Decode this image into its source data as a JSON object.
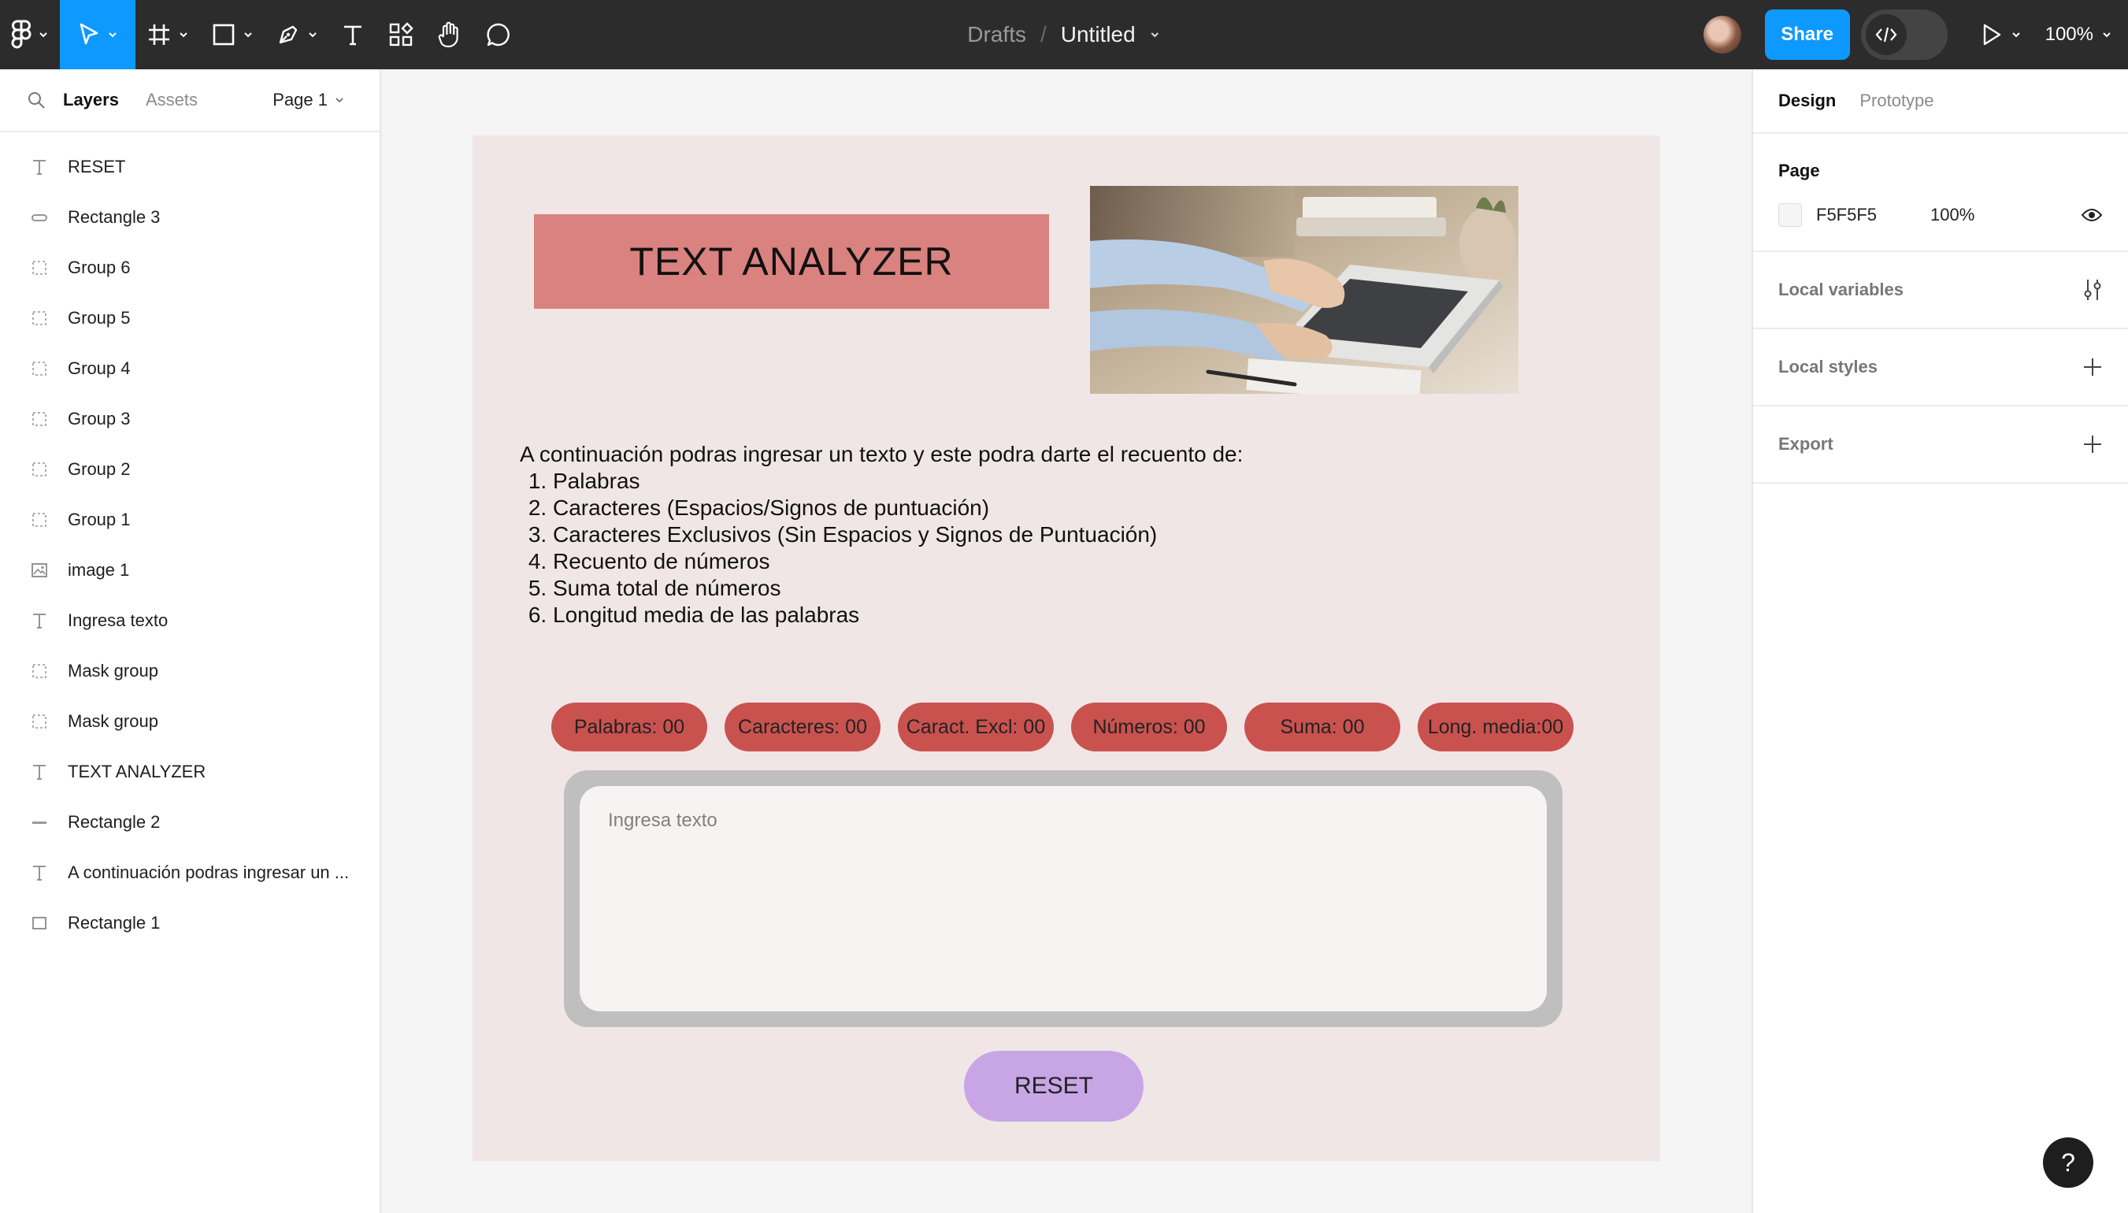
{
  "toolbar": {
    "file": {
      "drafts": "Drafts",
      "separator": "/",
      "name": "Untitled"
    },
    "share_label": "Share",
    "zoom": "100%"
  },
  "left_panel": {
    "tabs": {
      "layers": "Layers",
      "assets": "Assets"
    },
    "page_selector": "Page 1",
    "layers": [
      {
        "label": "RESET",
        "icon": "text-icon"
      },
      {
        "label": "Rectangle 3",
        "icon": "rounded-rect-icon"
      },
      {
        "label": "Group 6",
        "icon": "group-icon"
      },
      {
        "label": "Group 5",
        "icon": "group-icon"
      },
      {
        "label": "Group 4",
        "icon": "group-icon"
      },
      {
        "label": "Group 3",
        "icon": "group-icon"
      },
      {
        "label": "Group 2",
        "icon": "group-icon"
      },
      {
        "label": "Group 1",
        "icon": "group-icon"
      },
      {
        "label": "image 1",
        "icon": "image-icon"
      },
      {
        "label": "Ingresa texto",
        "icon": "text-icon"
      },
      {
        "label": "Mask group",
        "icon": "group-icon"
      },
      {
        "label": "Mask group",
        "icon": "group-icon"
      },
      {
        "label": "TEXT ANALYZER",
        "icon": "text-icon"
      },
      {
        "label": "Rectangle 2",
        "icon": "line-rect-icon"
      },
      {
        "label": "A continuación podras ingresar un ...",
        "icon": "text-icon"
      },
      {
        "label": "Rectangle 1",
        "icon": "rect-icon"
      }
    ]
  },
  "right_panel": {
    "tabs": {
      "design": "Design",
      "prototype": "Prototype"
    },
    "page": {
      "title": "Page",
      "color_hex": "F5F5F5",
      "opacity": "100%"
    },
    "local_variables": "Local variables",
    "local_styles": "Local styles",
    "export": "Export"
  },
  "help": "?",
  "design": {
    "title": "TEXT ANALYZER",
    "intro": "A continuación podras ingresar un texto y este podra darte el recuento de:",
    "list": [
      "Palabras",
      "Caracteres (Espacios/Signos de puntuación)",
      "Caracteres Exclusivos (Sin Espacios y Signos de Puntuación)",
      "Recuento de números",
      "Suma total de números",
      "Longitud media de las palabras"
    ],
    "stats": [
      "Palabras: 00",
      "Caracteres: 00",
      "Caract. Excl: 00",
      "Números: 00",
      "Suma: 00",
      "Long. media:00"
    ],
    "input_placeholder": "Ingresa texto",
    "reset_label": "RESET"
  },
  "colors": {
    "toolbar_bg": "#2c2c2c",
    "accent": "#0d99ff",
    "frame_bg": "#f1e6e6",
    "title_bg": "#d9827f",
    "pill_bg": "#c9524f",
    "reset_bg": "#c8a6e6"
  }
}
